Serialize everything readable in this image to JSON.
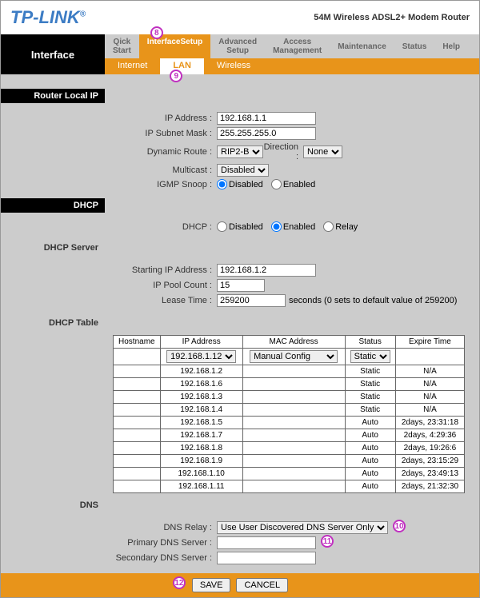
{
  "header": {
    "logo": "TP-LINK",
    "product": "54M Wireless ADSL2+ Modem Router"
  },
  "nav": {
    "title": "Interface",
    "tabs": [
      {
        "l1": "Qick",
        "l2": "Start"
      },
      {
        "l1": "Interface",
        "l2": "Setup"
      },
      {
        "l1": "Advanced",
        "l2": "Setup"
      },
      {
        "l1": "Access",
        "l2": "Management"
      },
      {
        "l1": "Maintenance",
        "l2": ""
      },
      {
        "l1": "Status",
        "l2": ""
      },
      {
        "l1": "Help",
        "l2": ""
      }
    ],
    "sub": [
      "Internet",
      "LAN",
      "Wireless"
    ]
  },
  "sections": {
    "routerLocalIp": "Router Local IP",
    "dhcp": "DHCP",
    "dhcpServer": "DHCP Server",
    "dhcpTable": "DHCP Table",
    "dns": "DNS"
  },
  "lan": {
    "ipAddressLbl": "IP Address :",
    "ipAddress": "192.168.1.1",
    "subnetLbl": "IP Subnet Mask :",
    "subnet": "255.255.255.0",
    "dynRouteLbl": "Dynamic Route :",
    "dynRoute": "RIP2-B",
    "directionLbl": "Direction :",
    "direction": "None",
    "multicastLbl": "Multicast :",
    "multicast": "Disabled",
    "igmpLbl": "IGMP Snoop :",
    "igmpDisabled": "Disabled",
    "igmpEnabled": "Enabled"
  },
  "dhcp": {
    "modeLbl": "DHCP :",
    "disabled": "Disabled",
    "enabled": "Enabled",
    "relay": "Relay",
    "startLbl": "Starting IP Address :",
    "start": "192.168.1.2",
    "poolLbl": "IP Pool Count :",
    "pool": "15",
    "leaseLbl": "Lease Time :",
    "lease": "259200",
    "leaseNote": "seconds   (0 sets to default value of 259200)"
  },
  "table": {
    "cols": [
      "Hostname",
      "IP Address",
      "MAC Address",
      "Status",
      "Expire Time"
    ],
    "ipSel": "192.168.1.12",
    "macSel": "Manual Config",
    "statusSel": "Static",
    "rows": [
      {
        "ip": "192.168.1.2",
        "mac": "",
        "status": "Static",
        "exp": "N/A"
      },
      {
        "ip": "192.168.1.6",
        "mac": "",
        "status": "Static",
        "exp": "N/A"
      },
      {
        "ip": "192.168.1.3",
        "mac": "",
        "status": "Static",
        "exp": "N/A"
      },
      {
        "ip": "192.168.1.4",
        "mac": "",
        "status": "Static",
        "exp": "N/A"
      },
      {
        "ip": "192.168.1.5",
        "mac": "",
        "status": "Auto",
        "exp": "2days, 23:31:18"
      },
      {
        "ip": "192.168.1.7",
        "mac": "",
        "status": "Auto",
        "exp": "2days, 4:29:36"
      },
      {
        "ip": "192.168.1.8",
        "mac": "",
        "status": "Auto",
        "exp": "2days, 19:26:6"
      },
      {
        "ip": "192.168.1.9",
        "mac": "",
        "status": "Auto",
        "exp": "2days, 23:15:29"
      },
      {
        "ip": "192.168.1.10",
        "mac": "",
        "status": "Auto",
        "exp": "2days, 23:49:13"
      },
      {
        "ip": "192.168.1.11",
        "mac": "",
        "status": "Auto",
        "exp": "2days, 21:32:30"
      }
    ]
  },
  "dns": {
    "relayLbl": "DNS Relay :",
    "relay": "Use User Discovered DNS Server Only",
    "primaryLbl": "Primary DNS Server :",
    "primary": "",
    "secondaryLbl": "Secondary DNS Server :",
    "secondary": ""
  },
  "footer": {
    "save": "SAVE",
    "cancel": "CANCEL"
  },
  "annotations": {
    "a8": "8",
    "a9": "9",
    "a10": "10",
    "a11": "11",
    "a12": "12"
  }
}
